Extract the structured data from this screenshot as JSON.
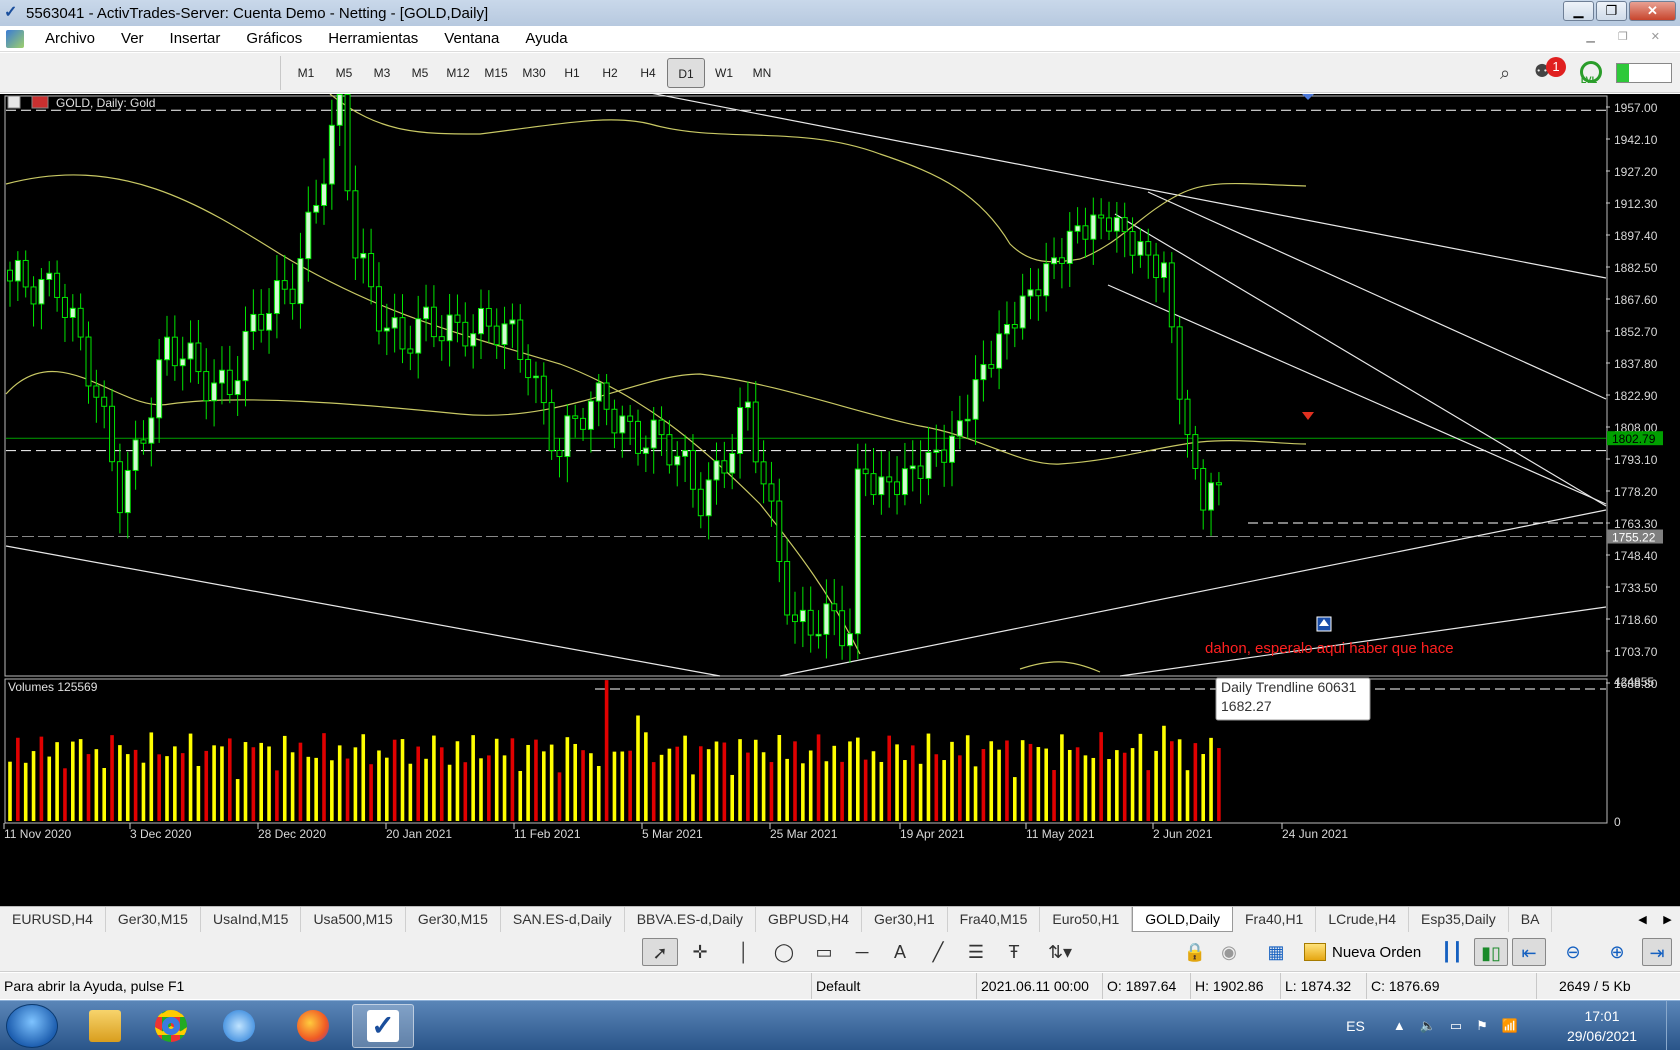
{
  "window": {
    "title": "5563041 - ActivTrades-Server: Cuenta Demo - Netting - [GOLD,Daily]",
    "minimize": "▁",
    "restore": "❐",
    "close": "✕"
  },
  "menu": {
    "items": [
      "Archivo",
      "Ver",
      "Insertar",
      "Gráficos",
      "Herramientas",
      "Ventana",
      "Ayuda"
    ]
  },
  "toolbar": {
    "timeframes": [
      "M1",
      "M5",
      "M3",
      "M5",
      "M12",
      "M15",
      "M30",
      "H1",
      "H2",
      "H4",
      "D1",
      "W1",
      "MN"
    ],
    "active_timeframe": "D1",
    "notification_count": "1",
    "lvl_label": "LVL"
  },
  "chart": {
    "header": "GOLD, Daily:  Gold",
    "annotation": "dahon, esperalo aqui haber que hace",
    "tooltip_line1": "Daily Trendline 60631",
    "tooltip_line2": "1682.27",
    "volumes_label": "Volumes 125569",
    "green_price_tag": "1802.79",
    "current_price_tag": "1755.22",
    "volume_axis_top": "424855",
    "volume_axis_bottom": "0",
    "colors": {
      "bull_candle": "#d2fad2",
      "bear_candle": "#000000",
      "candle_outline": "#00e600",
      "ma": "#c8c864",
      "grid": "#ffffff",
      "green_line": "#00a000",
      "vol_up": "#ffff00",
      "vol_down": "#e00000",
      "annotation": "#ff2020"
    }
  },
  "chart_data": {
    "type": "candlestick",
    "price_ticks": [
      "1957.00",
      "1942.10",
      "1927.20",
      "1912.30",
      "1897.40",
      "1882.50",
      "1867.60",
      "1852.70",
      "1837.80",
      "1822.90",
      "1808.00",
      "1793.10",
      "1778.20",
      "1763.30",
      "1748.40",
      "1733.50",
      "1718.60",
      "1703.70",
      "1688.80"
    ],
    "date_ticks": [
      "11 Nov 2020",
      "3 Dec 2020",
      "28 Dec 2020",
      "20 Jan 2021",
      "11 Feb 2021",
      "5 Mar 2021",
      "25 Mar 2021",
      "19 Apr 2021",
      "11 May 2021",
      "2 Jun 2021",
      "24 Jun 2021"
    ],
    "ylim": [
      1683,
      1960
    ]
  },
  "tabs": [
    "EURUSD,H4",
    "Ger30,M15",
    "UsaInd,M15",
    "Usa500,M15",
    "Ger30,M15",
    "SAN.ES-d,Daily",
    "BBVA.ES-d,Daily",
    "GBPUSD,H4",
    "Ger30,H1",
    "Fra40,M15",
    "Euro50,H1",
    "GOLD,Daily",
    "Fra40,H1",
    "LCrude,H4",
    "Esp35,Daily",
    "BA"
  ],
  "active_tab": "GOLD,Daily",
  "toolbar2": {
    "new_order": "Nueva Orden"
  },
  "status": {
    "help": "Para abrir la Ayuda, pulse F1",
    "profile": "Default",
    "datetime": "2021.06.11 00:00",
    "open": "O: 1897.64",
    "high": "H: 1902.86",
    "low": "L: 1874.32",
    "close": "C: 1876.69",
    "traffic": "2649 / 5 Kb"
  },
  "taskbar": {
    "lang": "ES",
    "time": "17:01",
    "date": "29/06/2021"
  }
}
